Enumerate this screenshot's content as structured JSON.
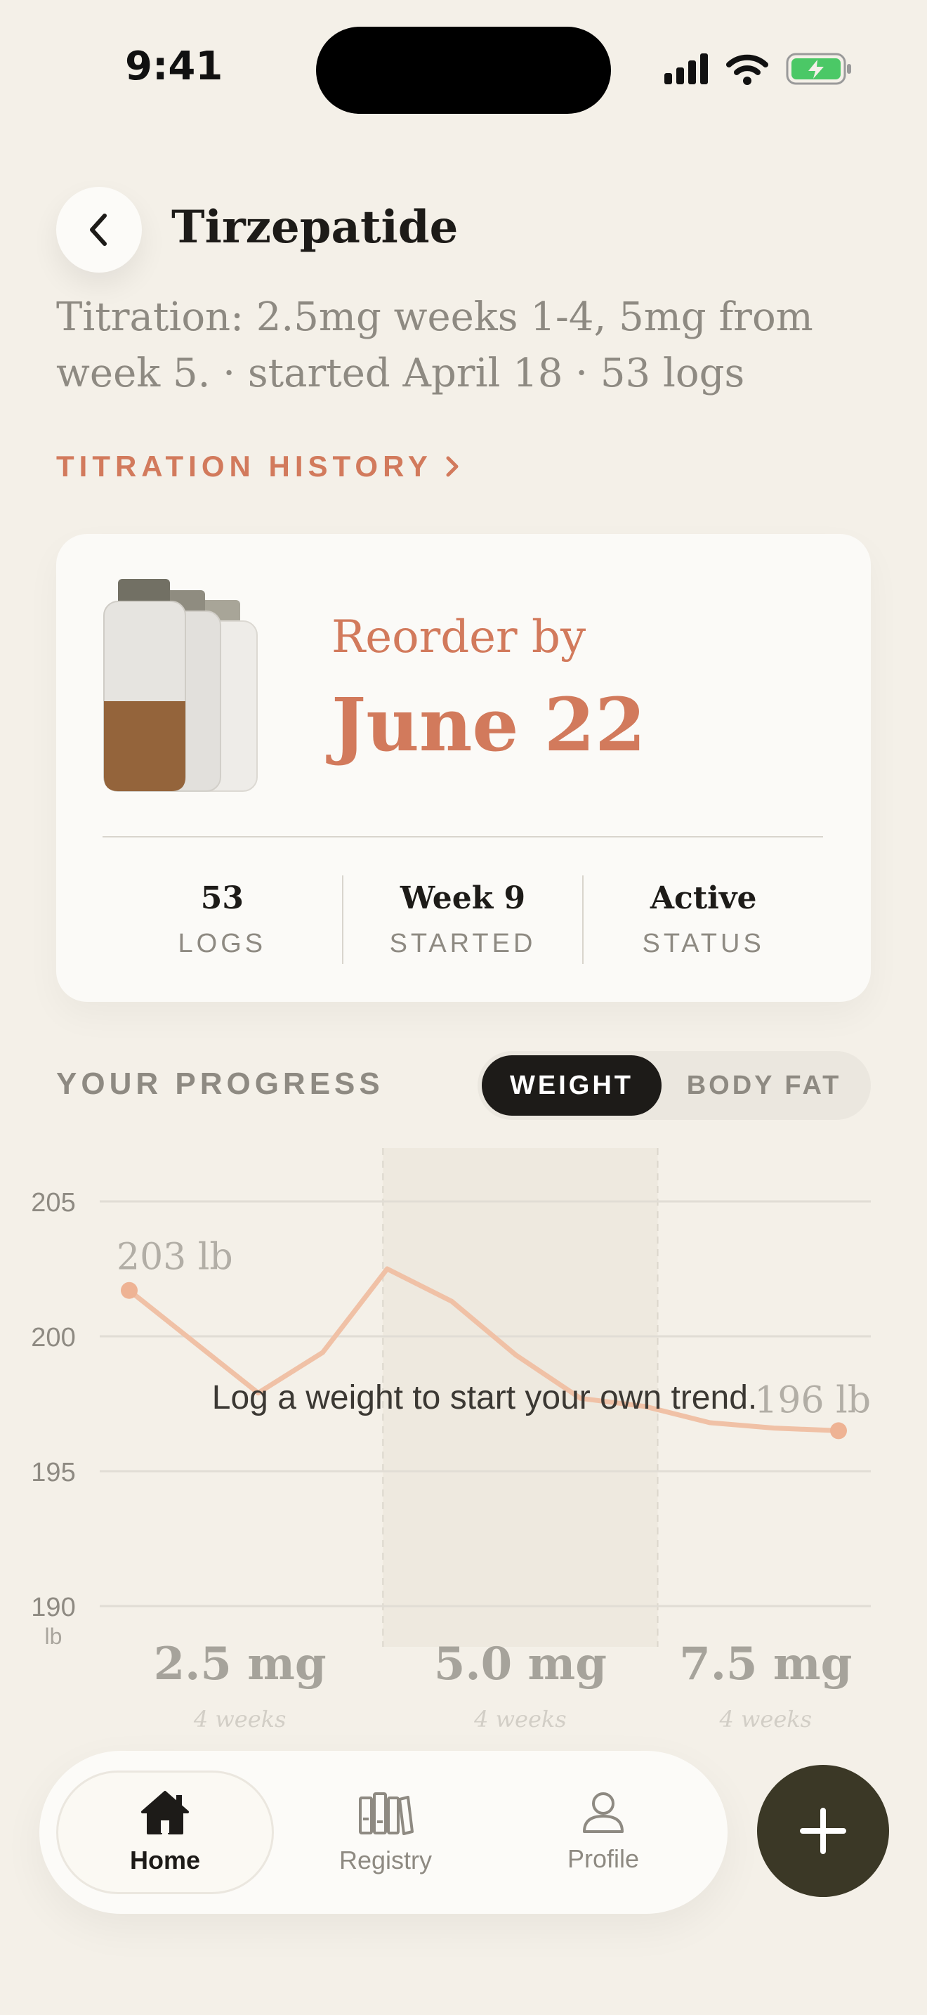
{
  "status_bar": {
    "time": "9:41"
  },
  "header": {
    "title": "Tirzepatide",
    "protocol": "Titration: 2.5mg weeks 1-4, 5mg from week 5.",
    "started": "started April 18",
    "logs": "53 logs",
    "separator": "·",
    "history_link": "TITRATION HISTORY"
  },
  "card": {
    "reorder_label": "Reorder by",
    "reorder_date": "June 22",
    "stats": [
      {
        "value": "53",
        "label": "LOGS"
      },
      {
        "value": "Week 9",
        "label": "STARTED"
      },
      {
        "value": "Active",
        "label": "STATUS"
      }
    ]
  },
  "progress": {
    "label": "YOUR PROGRESS",
    "toggle": [
      {
        "label": "WEIGHT",
        "active": true
      },
      {
        "label": "BODY FAT",
        "active": false
      }
    ],
    "empty_message": "Log a weight to start your own trend."
  },
  "chart_data": {
    "type": "line",
    "unit": "lb",
    "ylim": [
      190,
      205
    ],
    "yticks": [
      190,
      195,
      200,
      205
    ],
    "x": [
      0,
      1,
      2,
      3,
      4,
      5,
      6,
      7,
      8,
      9,
      10,
      11
    ],
    "series": [
      {
        "values": [
          201.7,
          199.8,
          197.9,
          199.4,
          202.5,
          201.3,
          199.3,
          197.7,
          197.4,
          196.8,
          196.6,
          196.5
        ]
      }
    ],
    "start_label": "203 lb",
    "end_label": "196 lb",
    "phases": [
      {
        "dose": "2.5 mg",
        "duration": "4 weeks",
        "start": 0,
        "end": 4,
        "highlighted": false
      },
      {
        "dose": "5.0 mg",
        "duration": "4 weeks",
        "start": 4,
        "end": 8,
        "highlighted": true
      },
      {
        "dose": "7.5 mg",
        "duration": "4 weeks",
        "start": 8,
        "end": 11,
        "highlighted": false
      }
    ],
    "grid": true,
    "colors": {
      "line": "#f0c1a6",
      "point": "#eeb394",
      "grid": "#e1ddd5",
      "band": "#eee9df"
    }
  },
  "nav": {
    "tabs": [
      {
        "label": "Home",
        "icon": "home-icon",
        "active": true
      },
      {
        "label": "Registry",
        "icon": "registry-icon",
        "active": false
      },
      {
        "label": "Profile",
        "icon": "profile-icon",
        "active": false
      }
    ],
    "fab_icon": "plus-icon"
  },
  "colors": {
    "accent": "#d27a5c",
    "background": "#f4f0e8",
    "card": "#fbfaf7",
    "ink": "#1d1b18",
    "muted": "#8e8a82",
    "vial_fill": "#94643b",
    "fab": "#3b3826"
  }
}
